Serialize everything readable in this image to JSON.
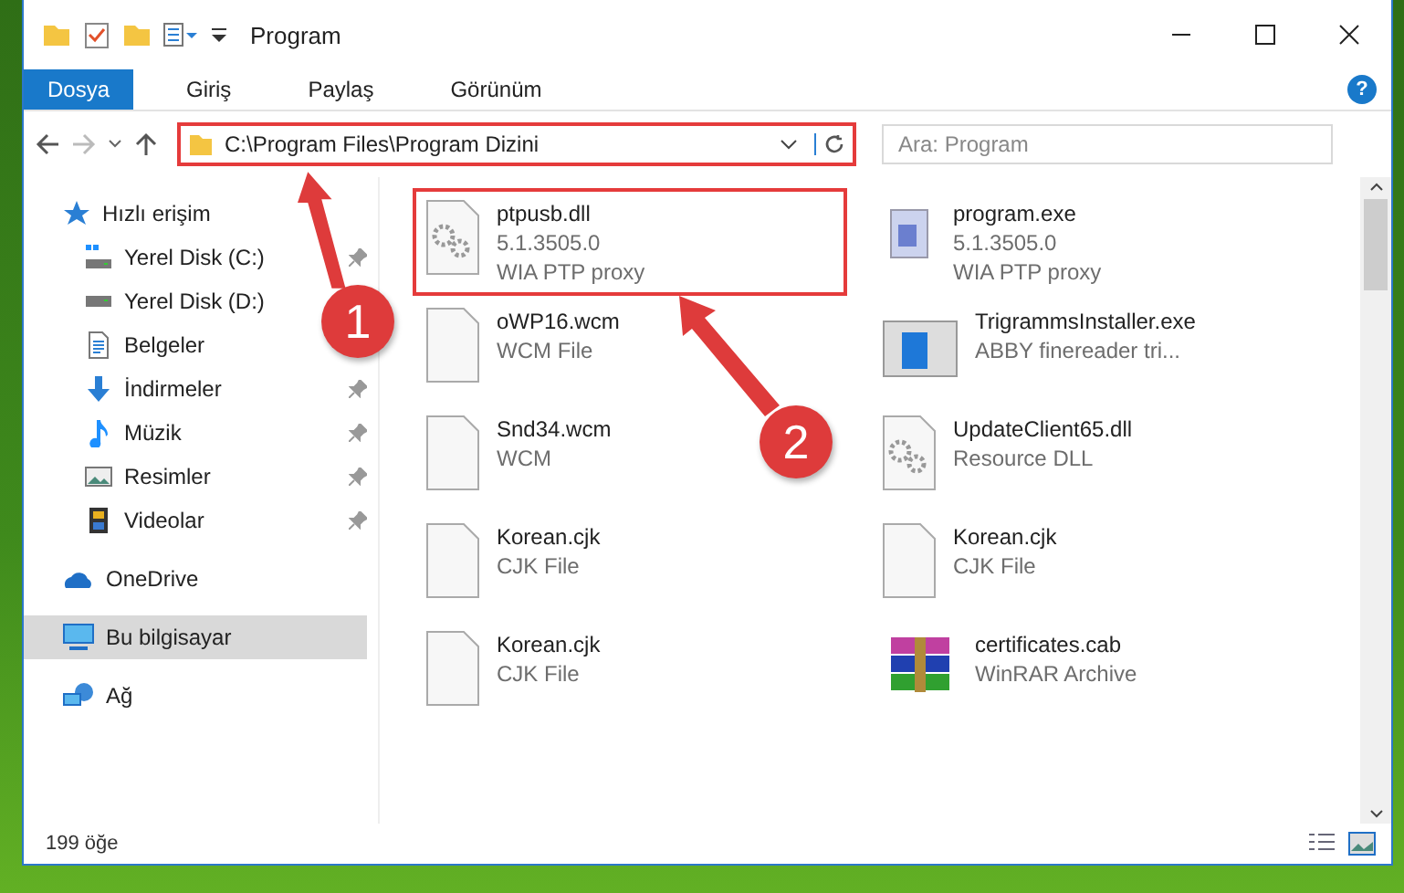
{
  "window": {
    "title": "Program"
  },
  "ribbon": {
    "tabs": [
      {
        "label": "Dosya",
        "selected": true
      },
      {
        "label": "Giriş",
        "selected": false
      },
      {
        "label": "Paylaş",
        "selected": false
      },
      {
        "label": "Görünüm",
        "selected": false
      }
    ],
    "help": "?"
  },
  "address": {
    "path": "C:\\Program Files\\Program Dizini",
    "highlighted": true
  },
  "search": {
    "placeholder": "Ara: Program"
  },
  "sidebar": {
    "items": [
      {
        "label": "Hızlı erişim",
        "kind": "star",
        "pinned": false,
        "selected": false
      },
      {
        "label": "Yerel Disk (C:)",
        "kind": "drive-c",
        "pinned": true,
        "selected": false
      },
      {
        "label": "Yerel Disk (D:)",
        "kind": "drive",
        "pinned": false,
        "selected": false
      },
      {
        "label": "Belgeler",
        "kind": "docs",
        "pinned": false,
        "selected": false
      },
      {
        "label": "İndirmeler",
        "kind": "download",
        "pinned": true,
        "selected": false
      },
      {
        "label": "Müzik",
        "kind": "music",
        "pinned": true,
        "selected": false
      },
      {
        "label": "Resimler",
        "kind": "pictures",
        "pinned": true,
        "selected": false
      },
      {
        "label": "Videolar",
        "kind": "videos",
        "pinned": true,
        "selected": false
      },
      {
        "label": "OneDrive",
        "kind": "cloud",
        "pinned": false,
        "selected": false
      },
      {
        "label": "Bu bilgisayar",
        "kind": "computer",
        "pinned": false,
        "selected": true
      },
      {
        "label": "Ağ",
        "kind": "network",
        "pinned": false,
        "selected": false
      }
    ]
  },
  "files": [
    {
      "name": "ptpusb.dll",
      "lines": [
        "5.1.3505.0",
        "WIA PTP proxy"
      ],
      "kind": "dll",
      "highlighted": true
    },
    {
      "name": "program.exe",
      "lines": [
        "5.1.3505.0",
        "WIA PTP proxy"
      ],
      "kind": "exe",
      "highlighted": false
    },
    {
      "name": "oWP16.wcm",
      "lines": [
        "WCM File"
      ],
      "kind": "blank",
      "highlighted": false
    },
    {
      "name": "TrigrammsInstaller.exe",
      "lines": [
        "ABBY finereader tri..."
      ],
      "kind": "installer",
      "highlighted": false
    },
    {
      "name": "Snd34.wcm",
      "lines": [
        "WCM"
      ],
      "kind": "blank",
      "highlighted": false
    },
    {
      "name": "UpdateClient65.dll",
      "lines": [
        "Resource DLL"
      ],
      "kind": "dll",
      "highlighted": false
    },
    {
      "name": "Korean.cjk",
      "lines": [
        "CJK File"
      ],
      "kind": "blank",
      "highlighted": false
    },
    {
      "name": "Korean.cjk",
      "lines": [
        "CJK File"
      ],
      "kind": "blank",
      "highlighted": false
    },
    {
      "name": "Korean.cjk",
      "lines": [
        "CJK File"
      ],
      "kind": "blank",
      "highlighted": false
    },
    {
      "name": "certificates.cab",
      "lines": [
        "WinRAR Archive"
      ],
      "kind": "archive",
      "highlighted": false
    }
  ],
  "status_bar": {
    "count": "199 öğe"
  },
  "callouts": [
    {
      "number": "1"
    },
    {
      "number": "2"
    }
  ]
}
